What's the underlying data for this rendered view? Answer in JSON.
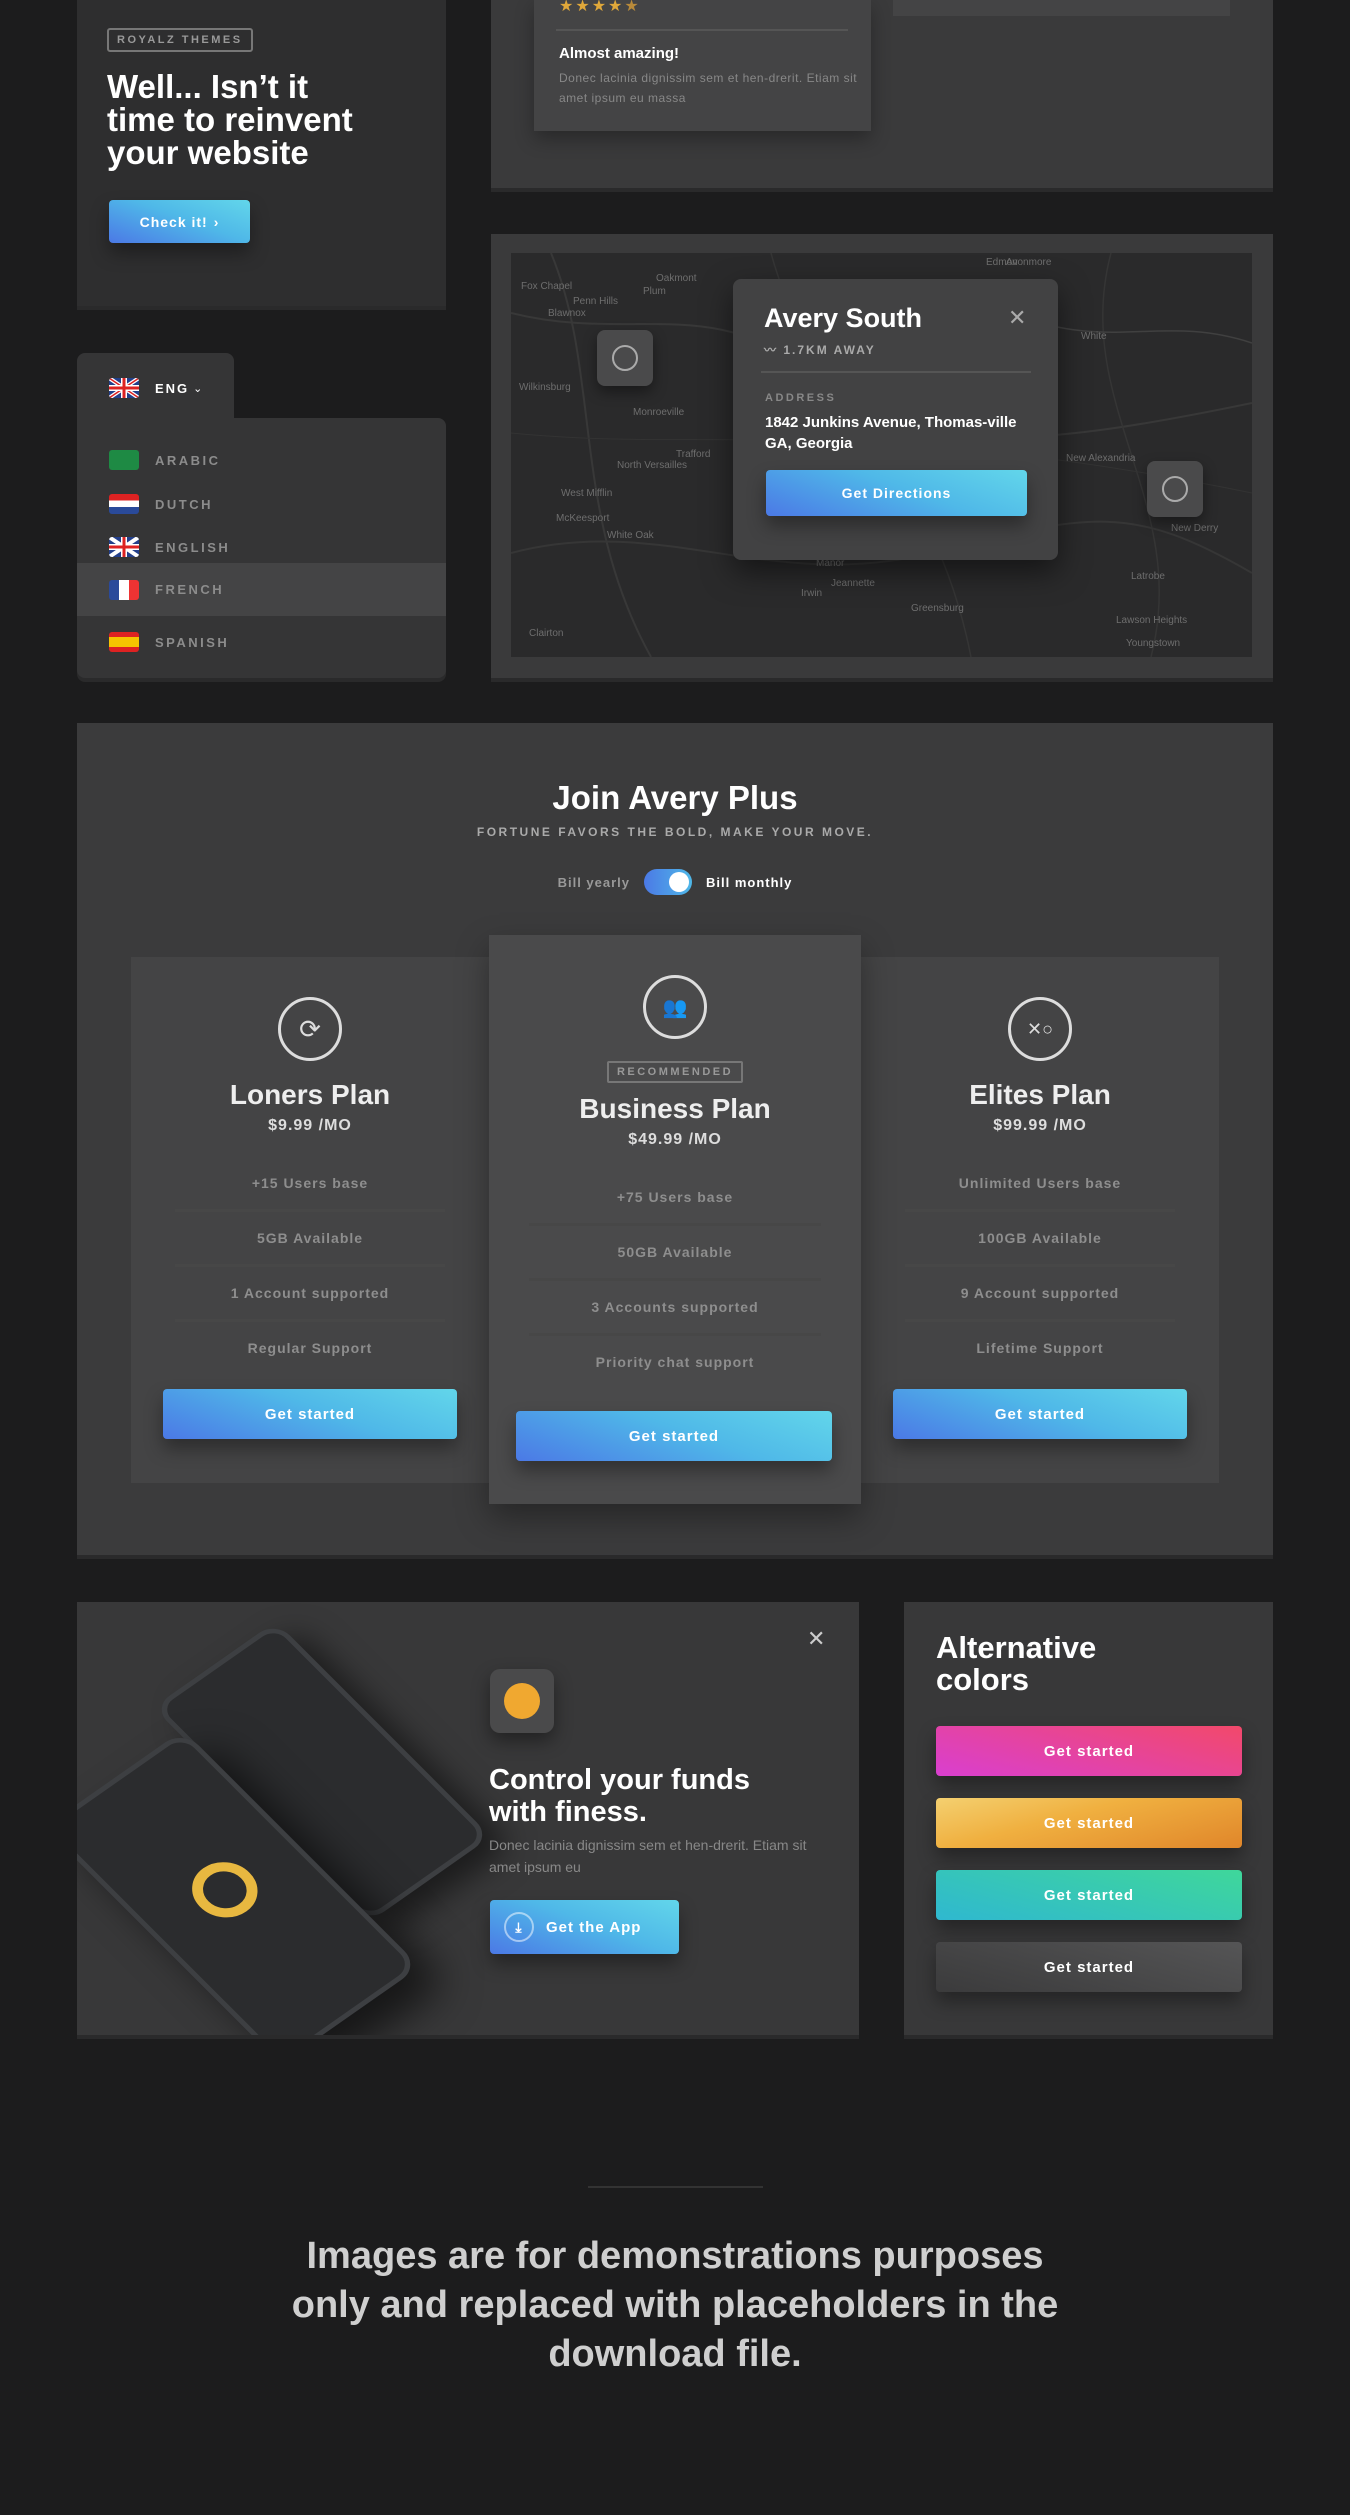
{
  "hero": {
    "badge": "ROYALZ THEMES",
    "title_lines": [
      "Well... Isn’t it",
      "time to reinvent",
      "your website"
    ],
    "cta": "Check it!",
    "cta_icon": "chevron-right-icon"
  },
  "language": {
    "current": "ENG",
    "items": [
      {
        "label": "ARABIC",
        "flag": "sa"
      },
      {
        "label": "DUTCH",
        "flag": "nl"
      },
      {
        "label": "ENGLISH",
        "flag": "gb"
      },
      {
        "label": "FRENCH",
        "flag": "fr",
        "highlighted": true
      },
      {
        "label": "SPANISH",
        "flag": "es"
      }
    ]
  },
  "review": {
    "stars": 5,
    "filled_stars": 4,
    "title": "Almost amazing!",
    "text": "Donec lacinia dignissim sem et hen-drerit. Etiam sit amet ipsum eu massa",
    "star_color": "#e0a83a"
  },
  "map": {
    "popup": {
      "title": "Avery South",
      "distance": "1.7KM AWAY",
      "address_label": "ADDRESS",
      "address": "1842 Junkins Avenue, Thomas-ville GA, Georgia",
      "button": "Get Directions"
    },
    "places": [
      "Oakmont",
      "Fox Chapel",
      "Penn Hills",
      "Blawnox",
      "Plum",
      "Wilkinsburg",
      "Monroeville",
      "North Versailles",
      "Trafford",
      "West Mifflin",
      "McKeesport",
      "White Oak",
      "Edmon",
      "Avonmore",
      "White",
      "New Alexandria",
      "New Derry",
      "Latrobe",
      "Greensburg",
      "Lawson Heights",
      "Youngstown",
      "Clairton",
      "Jeannette",
      "Manor",
      "Irwin"
    ]
  },
  "pricing": {
    "title": "Join Avery Plus",
    "subtitle": "FORTUNE FAVORS THE BOLD, MAKE YOUR MOVE.",
    "toggle": {
      "left": "Bill yearly",
      "right": "Bill monthly",
      "state": "monthly"
    },
    "plans": [
      {
        "name": "Loners Plan",
        "price": "$9.99 /MO",
        "icon": "refresh-cycle-icon",
        "features": [
          "+15 Users base",
          "5GB Available",
          "1 Account supported",
          "Regular Support"
        ],
        "button": "Get started"
      },
      {
        "name": "Business Plan",
        "price": "$49.99 /MO",
        "icon": "group-users-icon",
        "badge": "RECOMMENDED",
        "features": [
          "+75 Users base",
          "50GB Available",
          "3 Accounts supported",
          "Priority chat support"
        ],
        "button": "Get started"
      },
      {
        "name": "Elites Plan",
        "price": "$99.99 /MO",
        "icon": "strategy-play-icon",
        "features": [
          "Unlimited Users base",
          "100GB Available",
          "9 Account supported",
          "Lifetime Support"
        ],
        "button": "Get started"
      }
    ]
  },
  "app_promo": {
    "title_lines": [
      "Control your funds",
      "with finess."
    ],
    "text": "Donec lacinia dignissim sem et hen-drerit. Etiam sit amet ipsum eu",
    "button": "Get the App"
  },
  "alt_colors": {
    "title_lines": [
      "Alternative",
      "colors"
    ],
    "buttons": [
      {
        "label": "Get started",
        "colors": [
          "#d93fd0",
          "#f2496a"
        ]
      },
      {
        "label": "Get started",
        "colors": [
          "#e5892a",
          "#f4c654"
        ]
      },
      {
        "label": "Get started",
        "colors": [
          "#2fb8d0",
          "#3fd79a"
        ]
      },
      {
        "label": "Get started",
        "colors": [
          "#3b3b3c",
          "#555556"
        ]
      }
    ]
  },
  "footer": {
    "lines": [
      "Images are for demonstrations purposes",
      "only and replaced with placeholders in the",
      "download file."
    ]
  }
}
